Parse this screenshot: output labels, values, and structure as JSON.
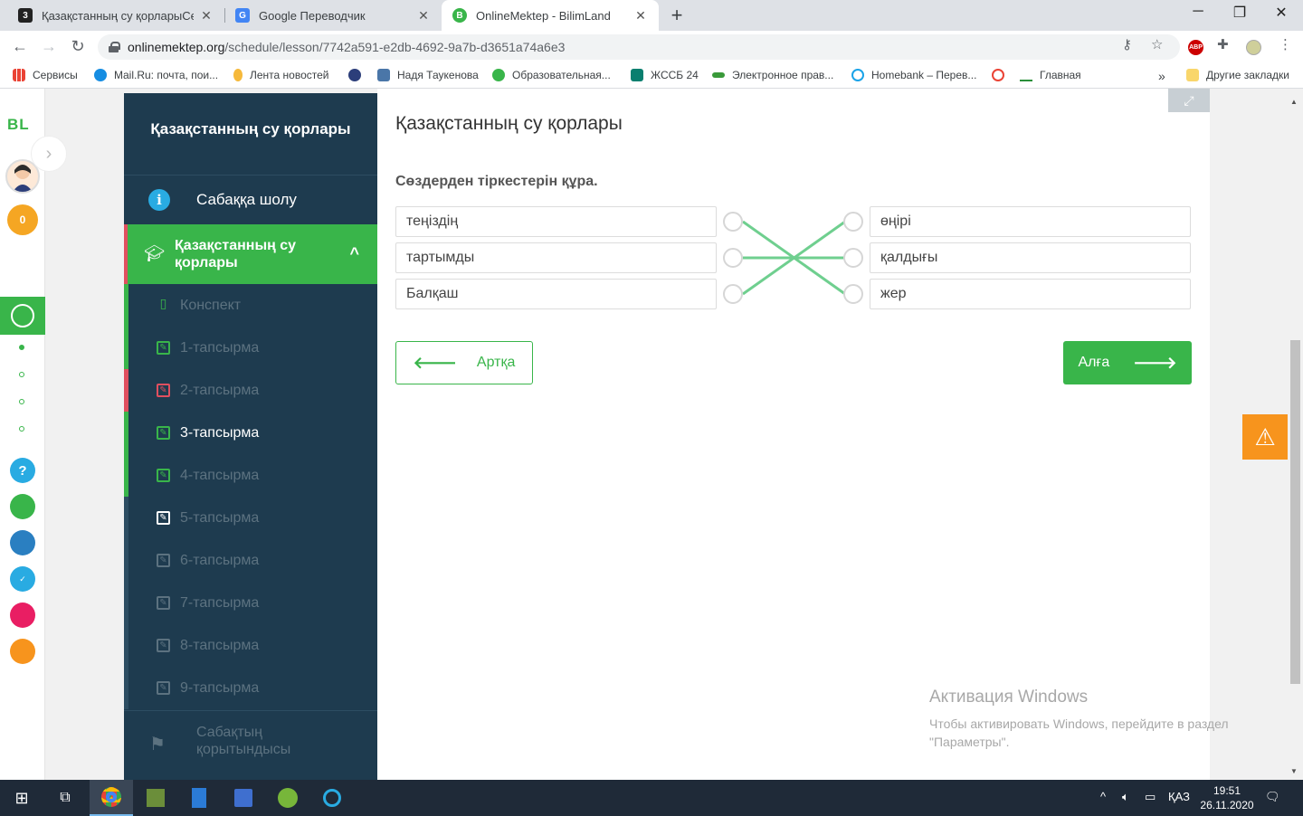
{
  "browser": {
    "tabs": [
      {
        "title": "Қазақстанның су қорларыСөзде",
        "favicon": "3"
      },
      {
        "title": "Google Переводчик",
        "favicon": "G"
      },
      {
        "title": "OnlineMektep - BilimLand",
        "favicon": "B"
      }
    ],
    "url_host": "onlinemektep.org",
    "url_path": "/schedule/lesson/7742a591-e2db-4692-9a7b-d3651a74a6e3",
    "bookmarks": [
      "Сервисы",
      "Mail.Ru: почта, пои...",
      "Лента новостей",
      "Надя Таукенова",
      "Образовательная...",
      "ЖССБ 24",
      "Электронное прав...",
      "Homebank – Перев...",
      "Главная"
    ],
    "other_bookmarks": "Другие закладки",
    "ext_abp": "ABP"
  },
  "rail": {
    "logo": "BL",
    "coins": "0"
  },
  "sidebar": {
    "title": "Қазақстанның су қорлары",
    "overview": "Сабаққа шолу",
    "lesson": "Қазақстанның су қорлары",
    "items": [
      {
        "label": "Конспект"
      },
      {
        "label": "1-тапсырма"
      },
      {
        "label": "2-тапсырма"
      },
      {
        "label": "3-тапсырма"
      },
      {
        "label": "4-тапсырма"
      },
      {
        "label": "5-тапсырма"
      },
      {
        "label": "6-тапсырма"
      },
      {
        "label": "7-тапсырма"
      },
      {
        "label": "8-тапсырма"
      },
      {
        "label": "9-тапсырма"
      }
    ],
    "summary": "Сабақтың қорытындысы"
  },
  "main": {
    "title": "Қазақстанның су қорлары",
    "instruction": "Сөздерден тіркестерін құра.",
    "left_words": [
      "теңіздің",
      "тартымды",
      "Балқаш"
    ],
    "right_words": [
      "өңірі",
      "қалдығы",
      "жер"
    ],
    "matches": [
      [
        0,
        2
      ],
      [
        1,
        1
      ],
      [
        2,
        0
      ]
    ],
    "back_label": "Артқа",
    "next_label": "Алға",
    "accent_color": "#39b54a"
  },
  "activation": {
    "heading": "Активация Windows",
    "text": "Чтобы активировать Windows, перейдите в раздел \"Параметры\"."
  },
  "taskbar": {
    "time": "19:51",
    "date": "26.11.2020",
    "lang": "ҚАЗ"
  }
}
